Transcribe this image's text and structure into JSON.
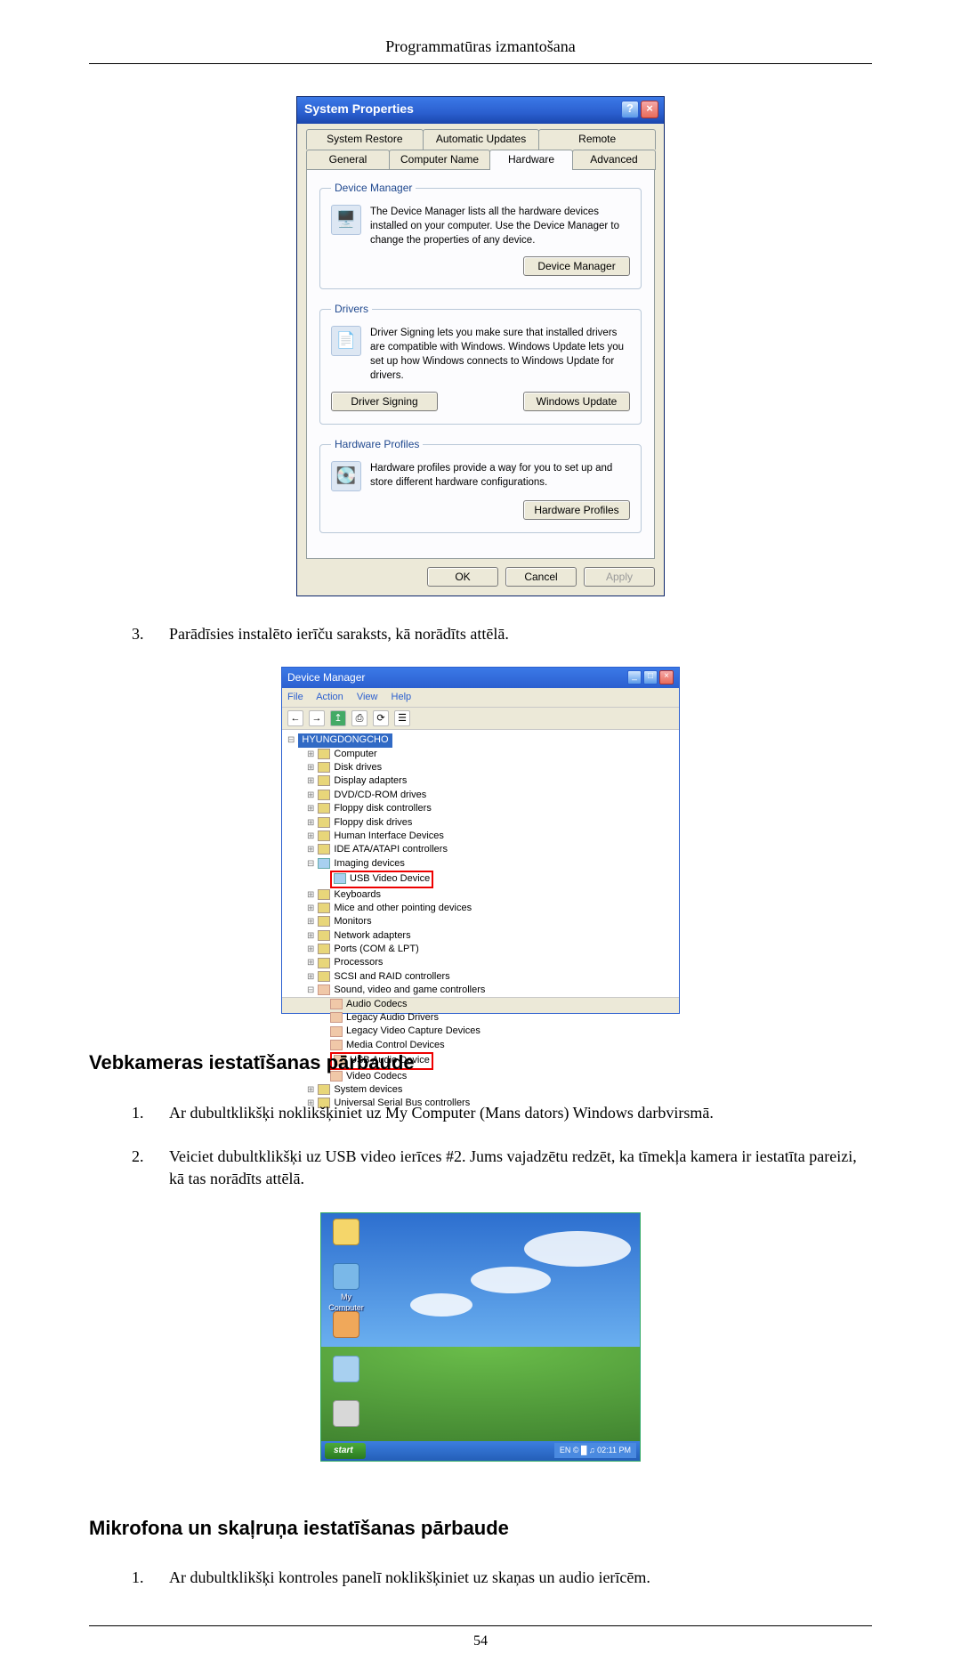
{
  "page_header": "Programmatūras izmantošana",
  "page_number": "54",
  "sysprops": {
    "title": "System Properties",
    "tabs_row1": [
      "System Restore",
      "Automatic Updates",
      "Remote"
    ],
    "tabs_row2": [
      "General",
      "Computer Name",
      "Hardware",
      "Advanced"
    ],
    "selected_tab": "Hardware",
    "devmgr": {
      "legend": "Device Manager",
      "text": "The Device Manager lists all the hardware devices installed on your computer. Use the Device Manager to change the properties of any device.",
      "button": "Device Manager"
    },
    "drivers": {
      "legend": "Drivers",
      "text": "Driver Signing lets you make sure that installed drivers are compatible with Windows. Windows Update lets you set up how Windows connects to Windows Update for drivers.",
      "button1": "Driver Signing",
      "button2": "Windows Update"
    },
    "hwprof": {
      "legend": "Hardware Profiles",
      "text": "Hardware profiles provide a way for you to set up and store different hardware configurations.",
      "button": "Hardware Profiles"
    },
    "footer": {
      "ok": "OK",
      "cancel": "Cancel",
      "apply": "Apply"
    }
  },
  "step3": {
    "num": "3.",
    "text": "Parādīsies instalēto ierīču saraksts, kā norādīts attēlā."
  },
  "devmgr_window": {
    "title": "Device Manager",
    "menu": [
      "File",
      "Action",
      "View",
      "Help"
    ],
    "root": "HYUNGDONGCHO",
    "items_top": [
      "Computer",
      "Disk drives",
      "Display adapters",
      "DVD/CD-ROM drives",
      "Floppy disk controllers",
      "Floppy disk drives",
      "Human Interface Devices",
      "IDE ATA/ATAPI controllers"
    ],
    "imaging": {
      "label": "Imaging devices",
      "child": "USB Video Device"
    },
    "items_mid": [
      "Keyboards",
      "Mice and other pointing devices",
      "Monitors",
      "Network adapters",
      "Ports (COM & LPT)",
      "Processors",
      "SCSI and RAID controllers"
    ],
    "sound": {
      "label": "Sound, video and game controllers",
      "children": [
        "Audio Codecs",
        "Legacy Audio Drivers",
        "Legacy Video Capture Devices",
        "Media Control Devices"
      ],
      "highlight": "USB Audio Device",
      "after": "Video Codecs"
    },
    "items_bottom": [
      "System devices",
      "Universal Serial Bus controllers"
    ]
  },
  "section_webcam": "Vebkameras iestatīšanas pārbaude",
  "webcam_steps": {
    "s1": {
      "num": "1.",
      "text": "Ar dubultklikšķi noklikšķiniet uz My Computer (Mans dators) Windows darbvirsmā."
    },
    "s2": {
      "num": "2.",
      "text": "Veiciet dubultklikšķi uz USB video ierīces #2. Jums vajadzētu redzēt, ka tīmekļa kamera ir iestatīta pareizi, kā tas norādīts attēlā."
    }
  },
  "desktop": {
    "start": "start",
    "tray": "EN  © █ ♫ 02:11 PM",
    "icons": [
      "",
      "My Computer",
      "",
      "",
      ""
    ]
  },
  "section_mic": "Mikrofona un skaļruņa iestatīšanas pārbaude",
  "mic_steps": {
    "s1": {
      "num": "1.",
      "text": "Ar dubultklikšķi kontroles panelī noklikšķiniet uz skaņas un audio ierīcēm."
    }
  }
}
